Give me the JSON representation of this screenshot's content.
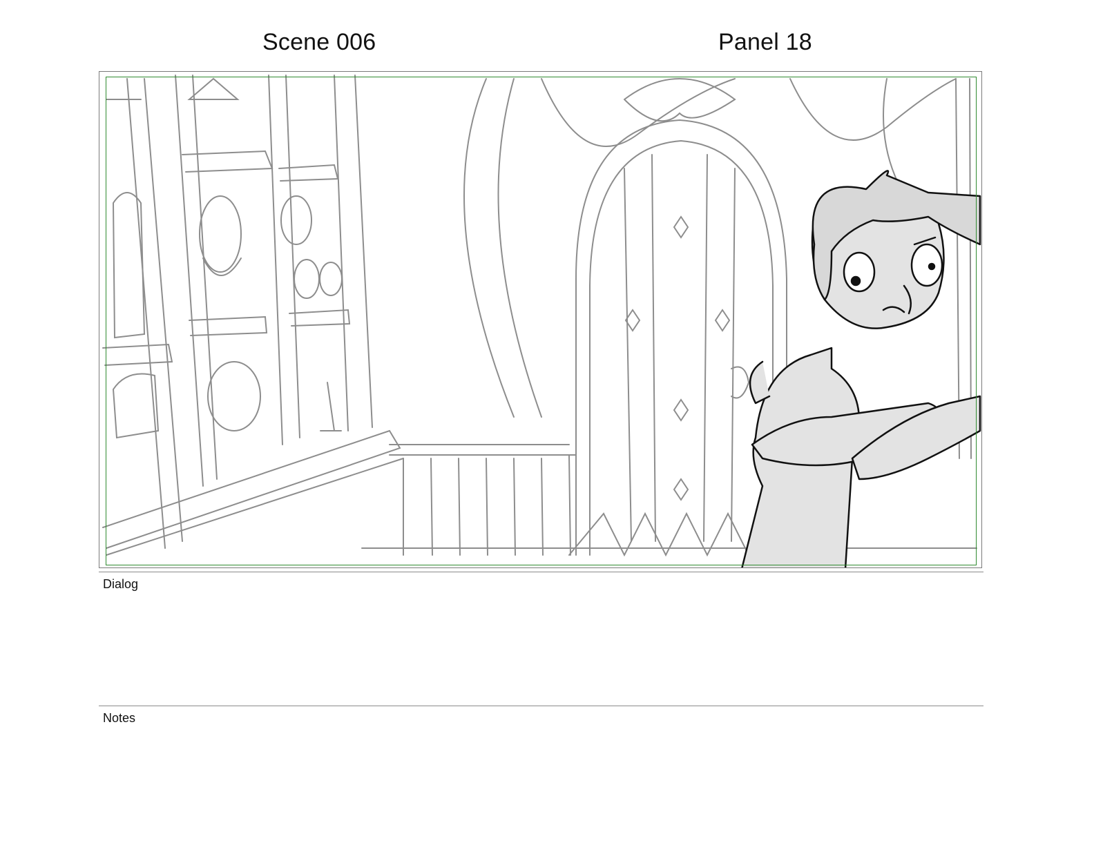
{
  "header": {
    "scene": "Scene 006",
    "panel": "Panel 18"
  },
  "sections": {
    "dialog_label": "Dialog",
    "notes_label": "Notes"
  },
  "panel_image": {
    "content": "rough pencil storyboard sketch: interior with shelves of jars on the left, arched studded door in the center, worried character leaning in from the right",
    "safe_area_color": "#2f8a2f"
  }
}
